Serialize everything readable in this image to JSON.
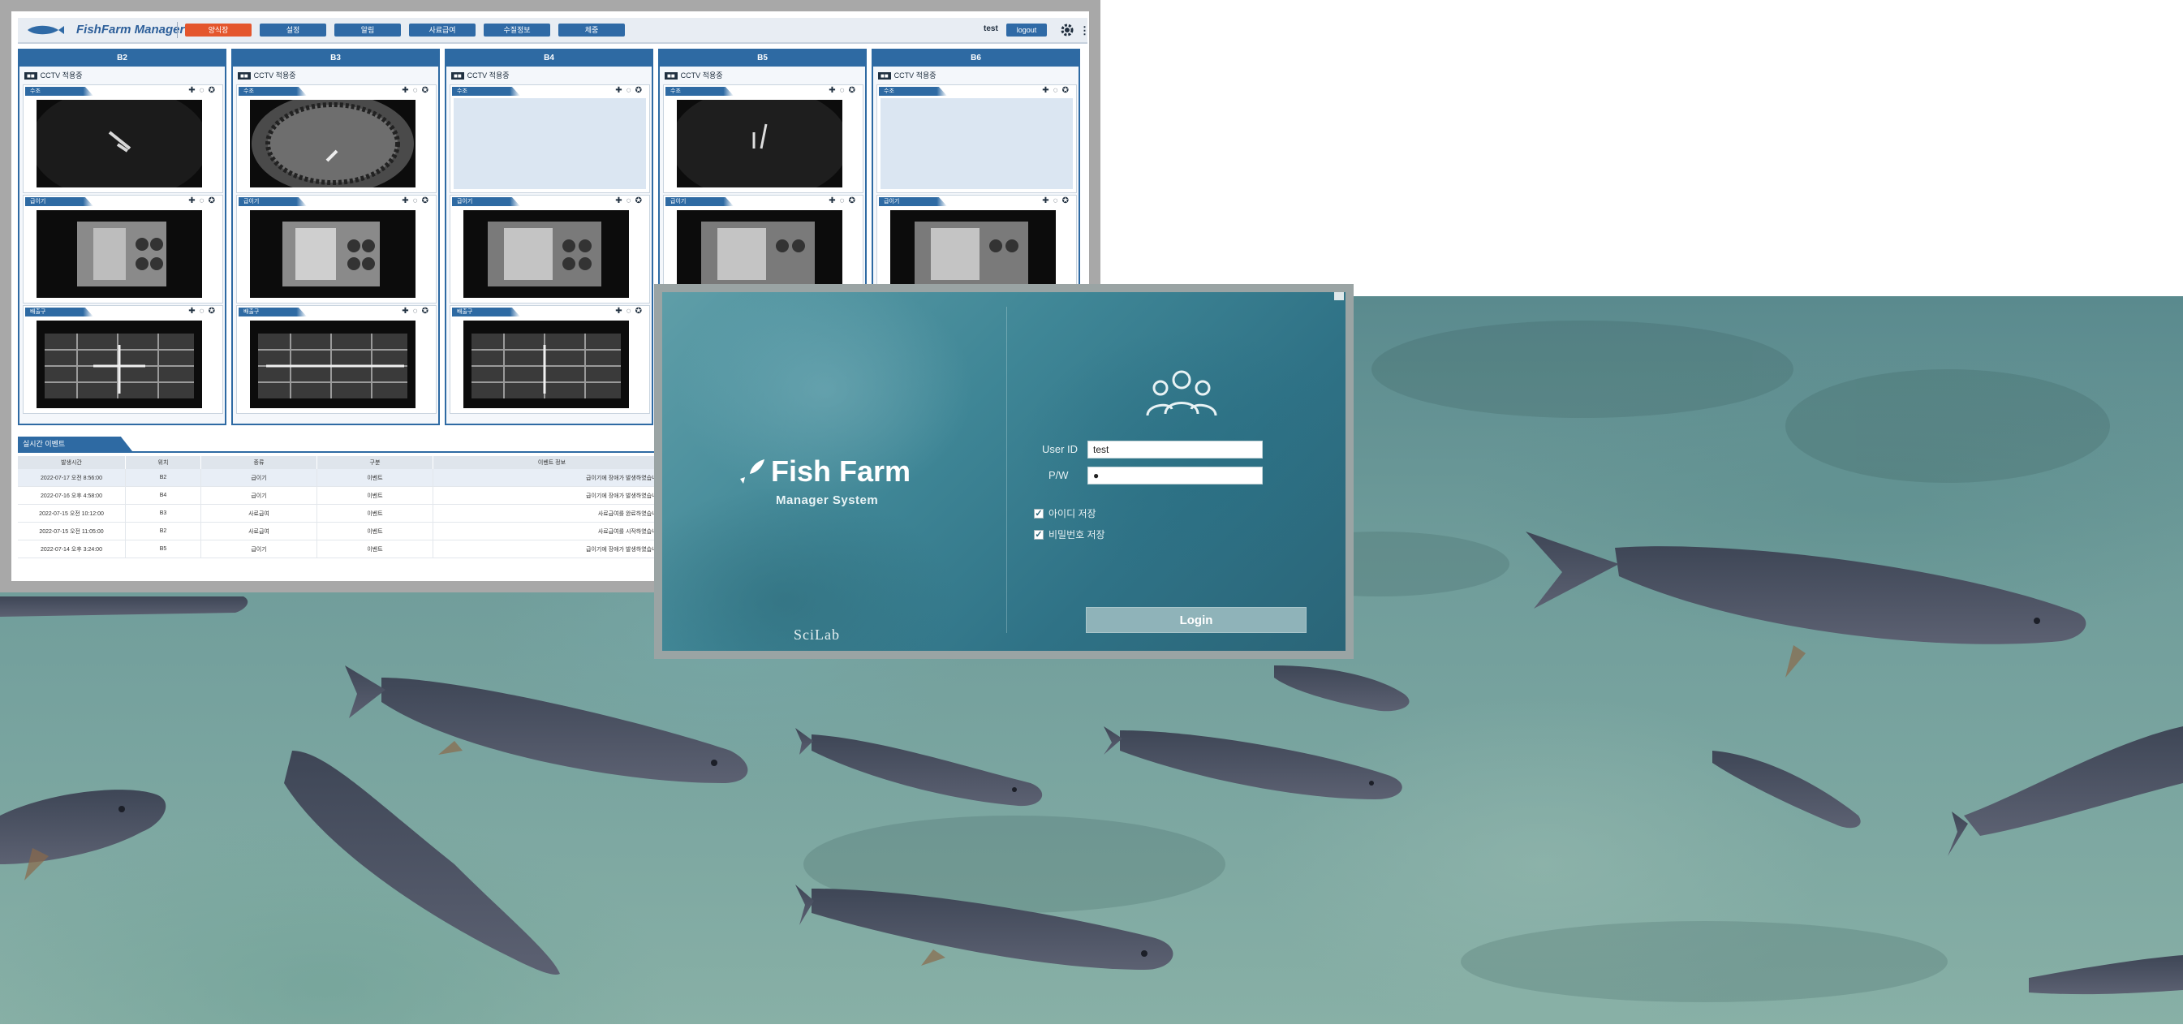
{
  "dashboard": {
    "title": "FishFarm Manager",
    "nav": [
      "양식장",
      "설정",
      "알림",
      "사료급여",
      "수질정보",
      "체중"
    ],
    "active_nav_index": 0,
    "user": "test",
    "logout_label": "logout",
    "accent_color": "#e4562d",
    "primary_color": "#2e6aa3",
    "columns": [
      {
        "title": "B2",
        "cctv_label": "CCTV 적용중",
        "feeds": [
          {
            "tag": "수조"
          },
          {
            "tag": "급이기"
          },
          {
            "tag": "배출구"
          }
        ]
      },
      {
        "title": "B3",
        "cctv_label": "CCTV 적용중",
        "feeds": [
          {
            "tag": "수조"
          },
          {
            "tag": "급이기"
          },
          {
            "tag": "배출구"
          }
        ]
      },
      {
        "title": "B4",
        "cctv_label": "CCTV 적용중",
        "feeds": [
          {
            "tag": "수조"
          },
          {
            "tag": "급이기"
          },
          {
            "tag": "배출구"
          }
        ]
      },
      {
        "title": "B5",
        "cctv_label": "CCTV 적용중",
        "feeds": [
          {
            "tag": "수조"
          },
          {
            "tag": "급이기"
          }
        ]
      },
      {
        "title": "B6",
        "cctv_label": "CCTV 적용중",
        "feeds": [
          {
            "tag": "수조"
          },
          {
            "tag": "급이기"
          }
        ]
      }
    ],
    "events_title": "실시간 이벤트",
    "events_headers": [
      "발생시간",
      "위치",
      "종류",
      "구분",
      "이벤트 정보"
    ],
    "events_rows": [
      [
        "2022-07-17 오전 8:56:00",
        "B2",
        "급이기",
        "이벤트",
        "급이기에 장애가 발생하였습니다."
      ],
      [
        "2022-07-16 오후 4:58:00",
        "B4",
        "급이기",
        "이벤트",
        "급이기에 장애가 발생하였습니다."
      ],
      [
        "2022-07-15 오전 10:12:00",
        "B3",
        "사료급여",
        "이벤트",
        "사료급여를 완료하였습니다."
      ],
      [
        "2022-07-15 오전 11:05:00",
        "B2",
        "사료급여",
        "이벤트",
        "사료급여를 시작하였습니다."
      ],
      [
        "2022-07-14 오후 3:24:00",
        "B5",
        "급이기",
        "이벤트",
        "급이기에 장애가 발생하였습니다."
      ]
    ]
  },
  "login": {
    "brand": "Fish Farm",
    "brand_sub": "Manager System",
    "company": "SciLab",
    "user_id_label": "User ID",
    "user_id_value": "test",
    "pw_label": "P/W",
    "pw_value": "●",
    "remember_id_label": "아이디 저장",
    "remember_pw_label": "비밀번호 저장",
    "remember_id_checked": true,
    "remember_pw_checked": true,
    "login_button": "Login"
  }
}
